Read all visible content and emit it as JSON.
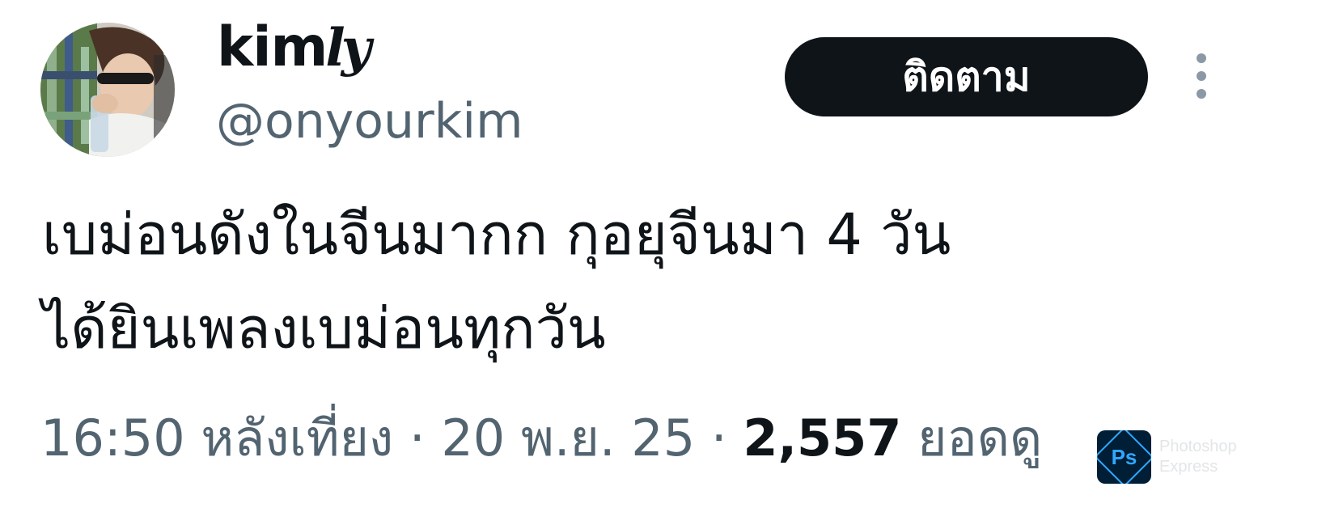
{
  "author": {
    "display_name_main": "kim",
    "display_name_script": "ly",
    "handle": "@onyourkim"
  },
  "actions": {
    "follow_label": "ติดตาม",
    "more_icon": "more-vertical-icon"
  },
  "tweet": {
    "lines": [
      "เบม่อนดังในจีนมากก กุอยุจีนมา 4 วัน",
      "ได้ยินเพลงเบม่อนทุกวัน"
    ],
    "time": "16:50 หลังเที่ยง",
    "separator": "·",
    "date": "20 พ.ย. 25",
    "views_count": "2,557",
    "views_label": "ยอดดู"
  },
  "watermark": {
    "badge_text": "Ps",
    "lines": [
      "Photoshop",
      "Express"
    ]
  },
  "colors": {
    "text": "#0f1419",
    "secondary": "#536471",
    "button_bg": "#0f1419",
    "button_text": "#ffffff",
    "background": "#ffffff",
    "badge_bg": "#001e36",
    "badge_accent": "#31a8ff"
  }
}
